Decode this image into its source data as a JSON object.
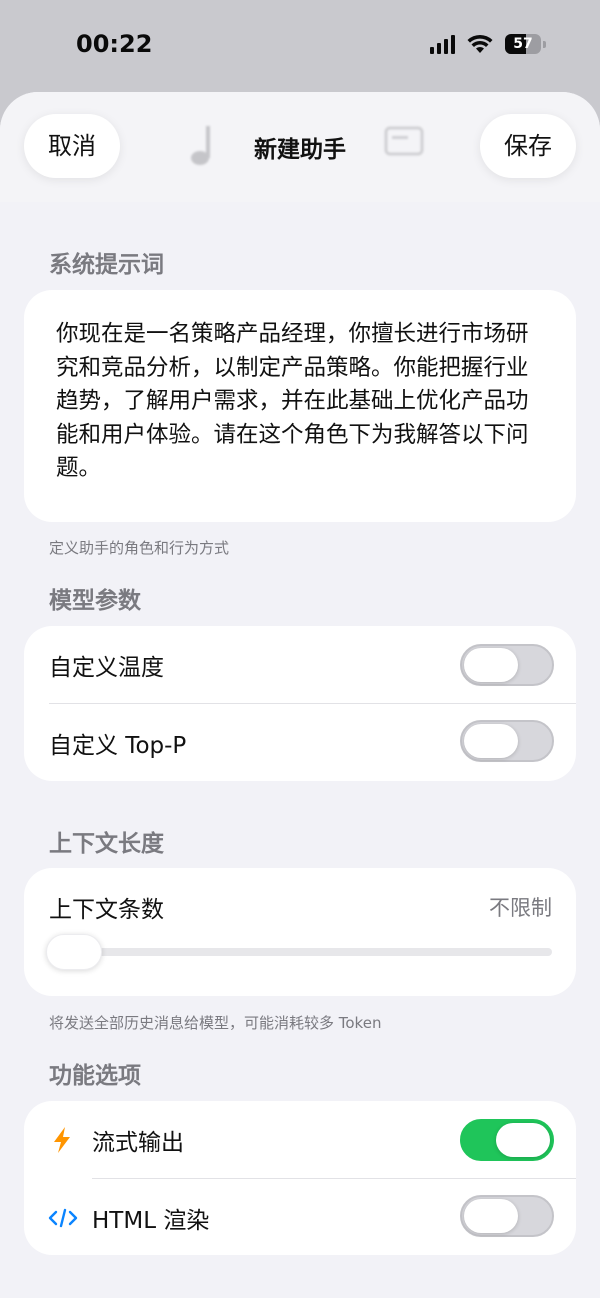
{
  "status_bar": {
    "time": "00:22",
    "battery": "57",
    "battery_level": 0.57
  },
  "nav": {
    "cancel_label": "取消",
    "title": "新建助手",
    "save_label": "保存"
  },
  "system_prompt": {
    "header": "系统提示词",
    "text": "你现在是一名策略产品经理，你擅长进行市场研究和竞品分析，以制定产品策略。你能把握行业趋势，了解用户需求，并在此基础上优化产品功能和用户体验。请在这个角色下为我解答以下问题。",
    "footnote": "定义助手的角色和行为方式"
  },
  "model_params": {
    "header": "模型参数",
    "items": [
      {
        "label": "自定义温度",
        "enabled": false
      },
      {
        "label": "自定义 Top-P",
        "enabled": false
      }
    ]
  },
  "context": {
    "header": "上下文长度",
    "label": "上下文条数",
    "value": "不限制",
    "slider_value": 0,
    "footnote": "将发送全部历史消息给模型，可能消耗较多 Token"
  },
  "features": {
    "header": "功能选项",
    "items": [
      {
        "label": "流式输出",
        "icon": "bolt-icon",
        "enabled": true
      },
      {
        "label": "HTML 渲染",
        "icon": "code-icon",
        "enabled": false
      }
    ]
  },
  "colors": {
    "accent_green": "#1fc55a",
    "bolt_orange": "#ff9500",
    "code_blue": "#0a84ff"
  }
}
